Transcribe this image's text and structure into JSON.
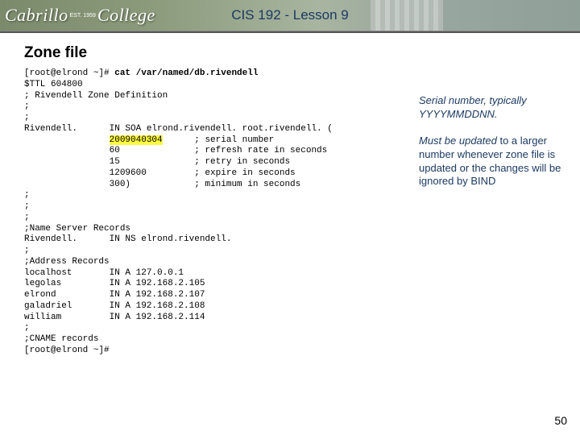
{
  "header": {
    "logo_text_left": "Cabrillo",
    "logo_est": "EST. 1959",
    "logo_text_right": "College",
    "title": "CIS 192 - Lesson 9"
  },
  "slide": {
    "title": "Zone file",
    "number": "50"
  },
  "terminal": {
    "prompt1": "[root@elrond ~]# ",
    "cmd": "cat /var/named/db.rivendell",
    "l2": "$TTL 604800",
    "l3": "; Rivendell Zone Definition",
    "l4": ";",
    "l5": ";",
    "l6": "Rivendell.      IN SOA elrond.rivendell. root.rivendell. (",
    "serial": "2009040304",
    "l7b": "      ; serial number",
    "l8": "                60              ; refresh rate in seconds",
    "l9": "                15              ; retry in seconds",
    "l10": "                1209600         ; expire in seconds",
    "l11": "                300)            ; minimum in seconds",
    "l12": ";",
    "l13": ";",
    "l14": ";",
    "l15": ";Name Server Records",
    "l16": "Rivendell.      IN NS elrond.rivendell.",
    "l17": ";",
    "l18": ";Address Records",
    "l19": "localhost       IN A 127.0.0.1",
    "l20": "legolas         IN A 192.168.2.105",
    "l21": "elrond          IN A 192.168.2.107",
    "l22": "galadriel       IN A 192.168.2.108",
    "l23": "william         IN A 192.168.2.114",
    "l24": ";",
    "l25": ";CNAME records",
    "l26": "[root@elrond ~]#"
  },
  "callout": {
    "p1a": "Serial number, typically YYYYMMDDNN.",
    "p2a": "Must be updated",
    "p2b": " to a larger number whenever zone file is updated or the changes will be ignored by BIND"
  }
}
